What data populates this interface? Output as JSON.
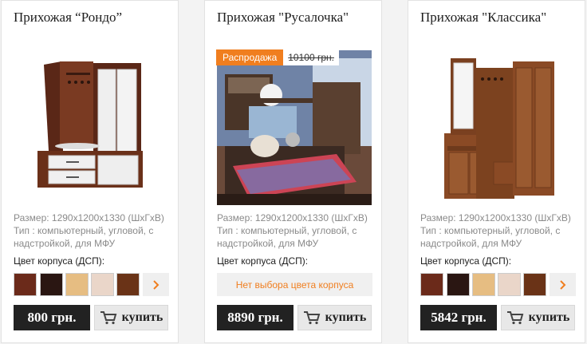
{
  "colors": {
    "accent": "#f07e1f",
    "price_bg": "#222222"
  },
  "products": [
    {
      "title": "Прихожая “Рондо”",
      "size": "Размер: 1290х1200х1330 (ШхГхВ)",
      "type": "Тип : компьютерный, угловой, с надстройкой, для МФУ",
      "color_label": "Цвет корпуса (ДСП):",
      "swatches": [
        "#6b2a1a",
        "#2a1612",
        "#e6bd82",
        "#ead6c9",
        "#6a3317"
      ],
      "price": "800 грн.",
      "buy_label": "купить"
    },
    {
      "title": "Прихожая \"Русалочка\"",
      "sale_label": "Распродажа",
      "old_price": "10100 грн.",
      "size": "Размер: 1290х1200х1330 (ШхГхВ)",
      "type": "Тип : компьютерный, угловой, с надстройкой, для МФУ",
      "color_label": "Цвет корпуса (ДСП):",
      "no_color_text": "Нет выбора цвета корпуса",
      "price": "8890 грн.",
      "buy_label": "купить"
    },
    {
      "title": "Прихожая \"Классика\"",
      "size": "Размер: 1290х1200х1330 (ШхГхВ)",
      "type": "Тип : компьютерный, угловой, с надстройкой, для МФУ",
      "color_label": "Цвет корпуса (ДСП):",
      "swatches": [
        "#6b2a1a",
        "#2a1612",
        "#e6bd82",
        "#ead6c9",
        "#6a3317"
      ],
      "price": "5842 грн.",
      "buy_label": "купить"
    }
  ]
}
